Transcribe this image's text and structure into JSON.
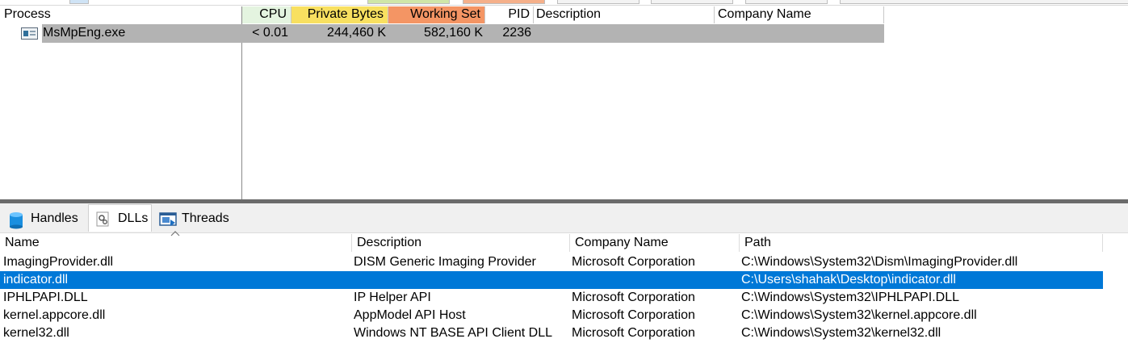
{
  "process_pane": {
    "columns": {
      "process": "Process",
      "cpu": "CPU",
      "private_bytes": "Private Bytes",
      "working_set": "Working Set",
      "pid": "PID",
      "description": "Description",
      "company_name": "Company Name"
    },
    "rows": [
      {
        "name": "MsMpEng.exe",
        "cpu": "< 0.01",
        "private_bytes": "244,460 K",
        "working_set": "582,160 K",
        "pid": "2236",
        "description": "",
        "company_name": ""
      }
    ],
    "colors": {
      "cpu": "#e4f4e0",
      "private_bytes": "#f8e060",
      "working_set": "#f49564",
      "selected_row": "#b3b3b3"
    }
  },
  "lower_pane": {
    "tabs": [
      {
        "label": "Handles",
        "icon": "cylinder-icon"
      },
      {
        "label": "DLLs",
        "icon": "gears-icon",
        "active": true
      },
      {
        "label": "Threads",
        "icon": "window-threads-icon"
      }
    ],
    "dll_columns": {
      "name": "Name",
      "description": "Description",
      "company_name": "Company Name",
      "path": "Path"
    },
    "dlls": [
      {
        "name": "ImagingProvider.dll",
        "description": "DISM Generic Imaging Provider",
        "company": "Microsoft Corporation",
        "path": "C:\\Windows\\System32\\Dism\\ImagingProvider.dll"
      },
      {
        "name": "indicator.dll",
        "description": "",
        "company": "",
        "path": "C:\\Users\\shahak\\Desktop\\indicator.dll",
        "selected": true
      },
      {
        "name": "IPHLPAPI.DLL",
        "description": "IP Helper API",
        "company": "Microsoft Corporation",
        "path": "C:\\Windows\\System32\\IPHLPAPI.DLL"
      },
      {
        "name": "kernel.appcore.dll",
        "description": "AppModel API Host",
        "company": "Microsoft Corporation",
        "path": "C:\\Windows\\System32\\kernel.appcore.dll"
      },
      {
        "name": "kernel32.dll",
        "description": "Windows NT BASE API Client DLL",
        "company": "Microsoft Corporation",
        "path": "C:\\Windows\\System32\\kernel32.dll"
      }
    ],
    "colors": {
      "selected_row": "#0078d7"
    }
  }
}
